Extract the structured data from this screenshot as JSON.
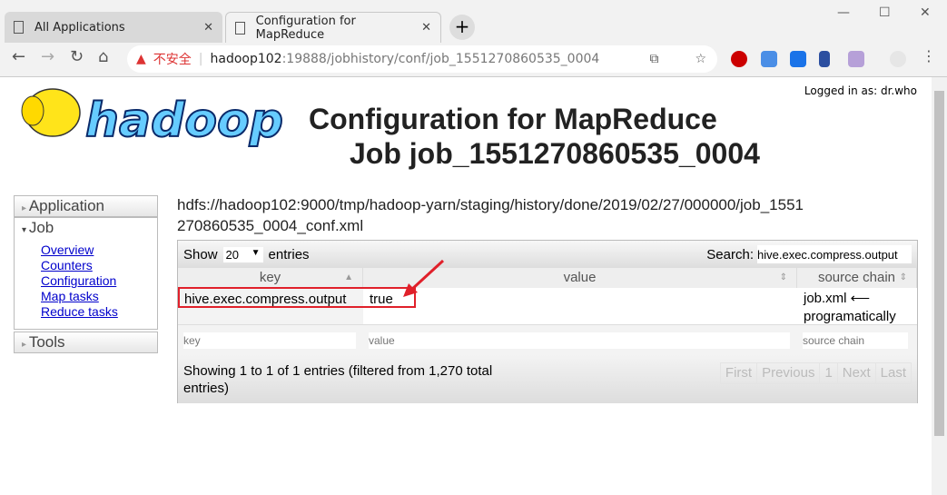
{
  "browser": {
    "tabs": [
      {
        "label": "All Applications"
      },
      {
        "label": "Configuration for MapReduce"
      }
    ],
    "security": "不安全",
    "url_host": "hadoop102",
    "url_path": ":19888/jobhistory/conf/job_1551270860535_0004"
  },
  "header": {
    "logo": "hadoop",
    "title_line1": "Configuration for MapReduce",
    "title_line2": "Job job_1551270860535_0004",
    "logged_in": "Logged in as: dr.who"
  },
  "sidebar": {
    "application": "Application",
    "job": "Job",
    "links": [
      "Overview",
      "Counters",
      "Configuration",
      "Map tasks",
      "Reduce tasks"
    ],
    "tools": "Tools"
  },
  "main": {
    "path": "hdfs://hadoop102:9000/tmp/hadoop-yarn/staging/history/done/2019/02/27/000000/job_1551270860535_0004_conf.xml",
    "show": "Show",
    "page_size": "20",
    "entries": "entries",
    "search_label": "Search:",
    "search_value": "hive.exec.compress.output",
    "columns": [
      "key",
      "value",
      "source chain"
    ],
    "rows": [
      {
        "key": "hive.exec.compress.output",
        "value": "true",
        "source": "job.xml ⟵ programatically"
      }
    ],
    "filters": [
      "key",
      "value",
      "source chain"
    ],
    "info": "Showing 1 to 1 of 1 entries (filtered from 1,270 total entries)",
    "pager": [
      "First",
      "Previous",
      "1",
      "Next",
      "Last"
    ]
  },
  "colors": {
    "highlight": "#e0202a",
    "link": "#0000cc"
  }
}
